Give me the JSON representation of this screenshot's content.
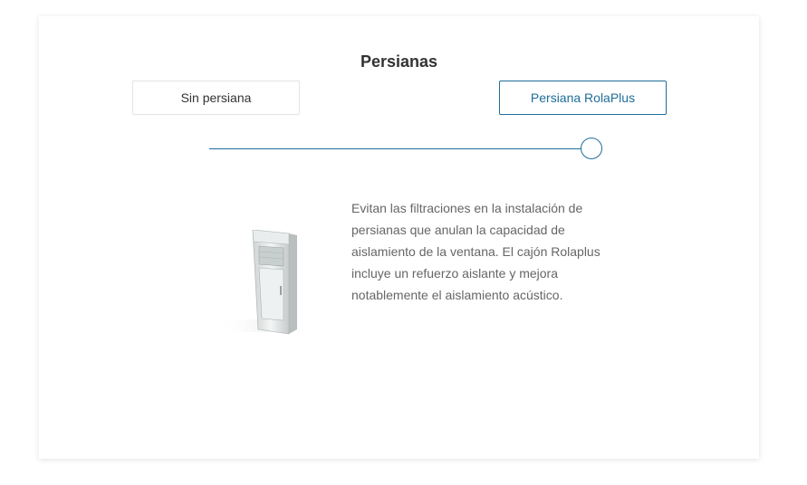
{
  "section": {
    "title": "Persianas"
  },
  "options": {
    "left_label": "Sin persiana",
    "right_label": "Persiana RolaPlus",
    "selected": "Persiana RolaPlus"
  },
  "slider": {
    "value_fraction": 1.0
  },
  "description": "Evitan las filtraciones en la instalación de persianas que anulan la capacidad de aislamiento de la ventana. El cajón Rolaplus incluye un refuerzo aislante y mejora notablemente el aislamiento acústico.",
  "colors": {
    "accent": "#1f6e9a",
    "text": "#333333",
    "muted_text": "#666666"
  }
}
